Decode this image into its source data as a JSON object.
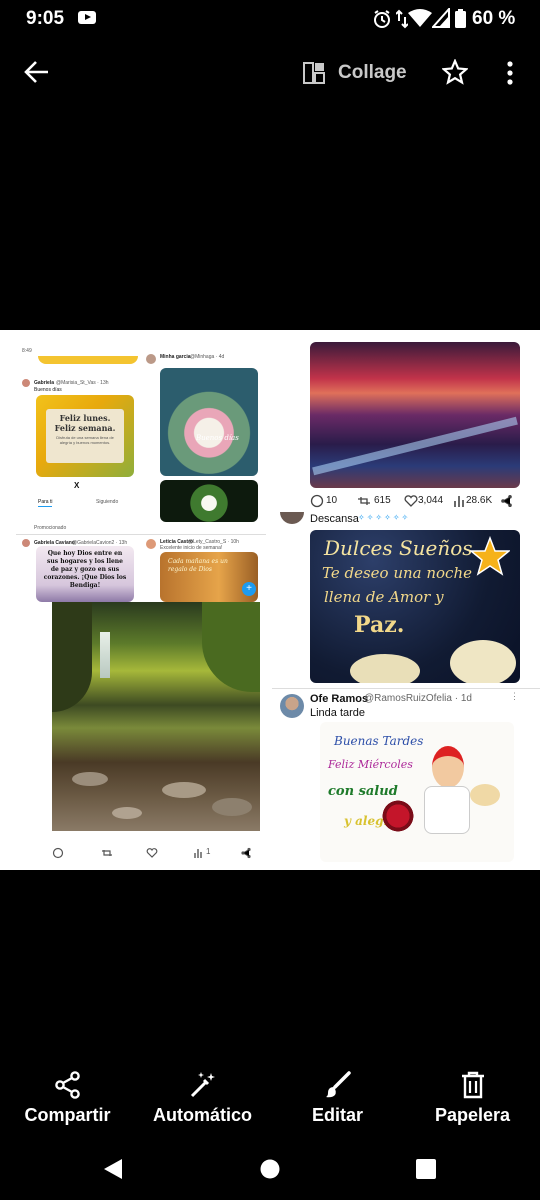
{
  "status_bar": {
    "time": "9:05",
    "battery_text": "60 %"
  },
  "app_bar": {
    "collage_label": "Collage"
  },
  "collage": {
    "left": {
      "phone_status": "8:49",
      "tweet1_user": "Gabriela",
      "tweet1_handle": "@Marisia_St_Vas · 13h",
      "tweet1_text": "Buenos días",
      "card1_line1": "Feliz lunes.",
      "card1_line2": "Feliz semana.",
      "card1_sub": "Disfruta de una semana llena de alegría y buenos momentos.",
      "x_logo": "X",
      "tab_para_ti": "Para ti",
      "tab_siguiendo": "Siguiendo",
      "pinned": "Promocionado",
      "tweet2_user": "Minha garcia",
      "tweet2_handle": "@Minhaga · 4d",
      "card2_text": "Buenos días",
      "tweet3_user": "Gabriela Caviano",
      "tweet3_handle": "@GabrielaCavion2 · 13h",
      "card3_text": "Que hoy Dios entre en sus hogares y los llene de paz y gozo en sus corazones. ¡Que Dios los Bendiga!",
      "tweet4_user": "Leticia Castro",
      "tweet4_handle": "@Lety_Castro_S · 10h",
      "tweet4_text": "Excelente inicio de semana!",
      "card4_text": "Cada mañana es un regalo de Dios",
      "stat_views": "1"
    },
    "right": {
      "stats": {
        "replies": "10",
        "retweets": "615",
        "likes": "3,044",
        "views": "28.6K"
      },
      "descansa": "Descansa",
      "card_title": "Dulces Sueños",
      "card_line1": "Te deseo una noche",
      "card_line2": "llena de Amor y",
      "card_line3": "Paz.",
      "tweet_user": "Ofe Ramos",
      "tweet_handle": "@RamosRuizOfelia · 1d",
      "tweet_text": "Linda tarde",
      "tarde_line1": "Buenas Tardes",
      "tarde_line2": "Feliz Miércoles",
      "tarde_line3": "con salud",
      "tarde_line4": "y alegría"
    }
  },
  "actions": [
    {
      "label": "Compartir",
      "icon": "share-icon"
    },
    {
      "label": "Automático",
      "icon": "magic-wand-icon"
    },
    {
      "label": "Editar",
      "icon": "brush-icon"
    },
    {
      "label": "Papelera",
      "icon": "trash-icon"
    }
  ],
  "colors": {
    "background": "#000000",
    "foreground": "#ffffff",
    "collage_label": "#c9c9c9"
  }
}
